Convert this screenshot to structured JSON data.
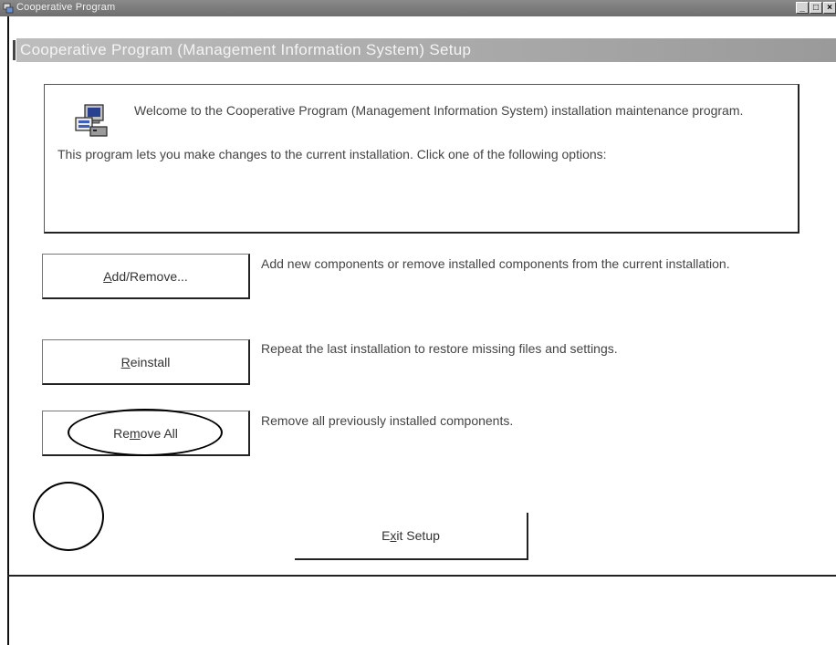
{
  "window": {
    "title": "Cooperative Program",
    "controls": {
      "minimize": "_",
      "maximize": "□",
      "close": "×"
    }
  },
  "header": {
    "title": "Cooperative Program (Management Information System) Setup"
  },
  "info": {
    "welcome": "Welcome to the Cooperative Program (Management Information System) installation maintenance program.",
    "description": "This program lets you make changes to the current installation. Click one of the following options:"
  },
  "options": [
    {
      "label_prefix": "",
      "label_mnemonic": "A",
      "label_suffix": "dd/Remove...",
      "description": "Add new components or remove installed components from the current installation."
    },
    {
      "label_prefix": "",
      "label_mnemonic": "R",
      "label_suffix": "einstall",
      "description": "Repeat the last installation to restore missing files and settings."
    },
    {
      "label_prefix": "Re",
      "label_mnemonic": "m",
      "label_suffix": "ove All",
      "description": "Remove all previously installed components."
    }
  ],
  "exit": {
    "label_prefix": "E",
    "label_mnemonic": "x",
    "label_suffix": "it Setup"
  }
}
